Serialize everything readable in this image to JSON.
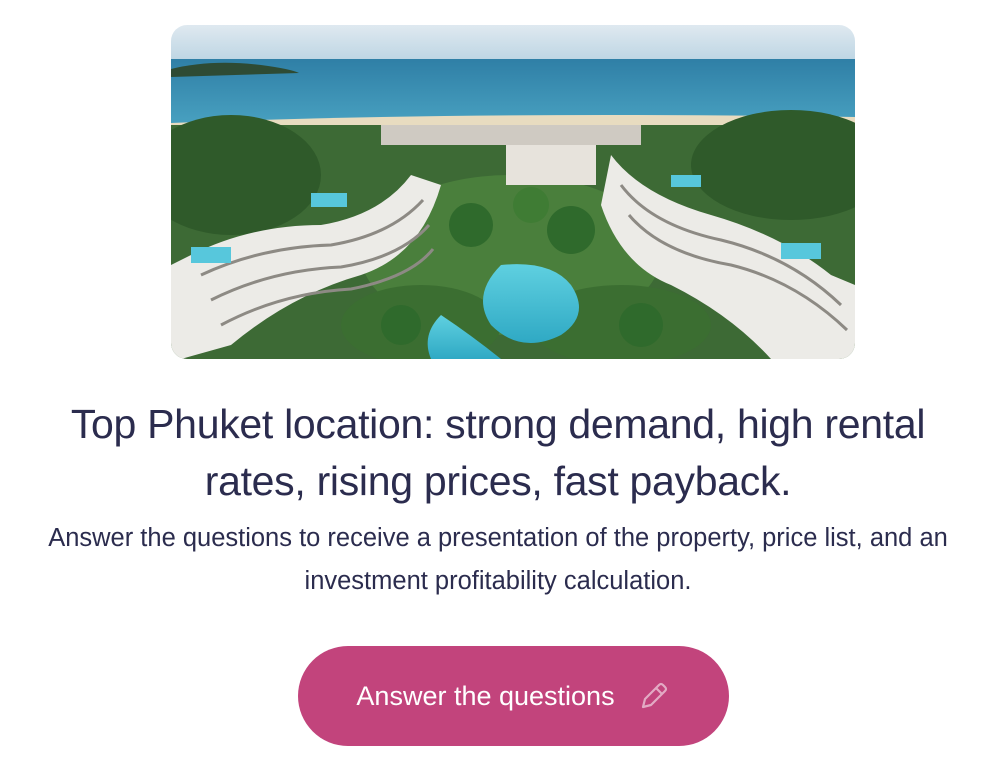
{
  "hero_image": {
    "alt": "Aerial view of a resort complex with curved residential buildings, pools and tropical gardens by the sea"
  },
  "headline": "Top Phuket location: strong demand, high rental rates, rising prices, fast payback.",
  "subtext": "Answer the questions to receive a presentation of the property, price list, and an investment profitability calculation.",
  "cta": {
    "label": "Answer the questions",
    "icon": "pencil-icon"
  },
  "colors": {
    "text": "#2b2c4e",
    "button": "#c2447c",
    "button_text": "#ffffff"
  }
}
